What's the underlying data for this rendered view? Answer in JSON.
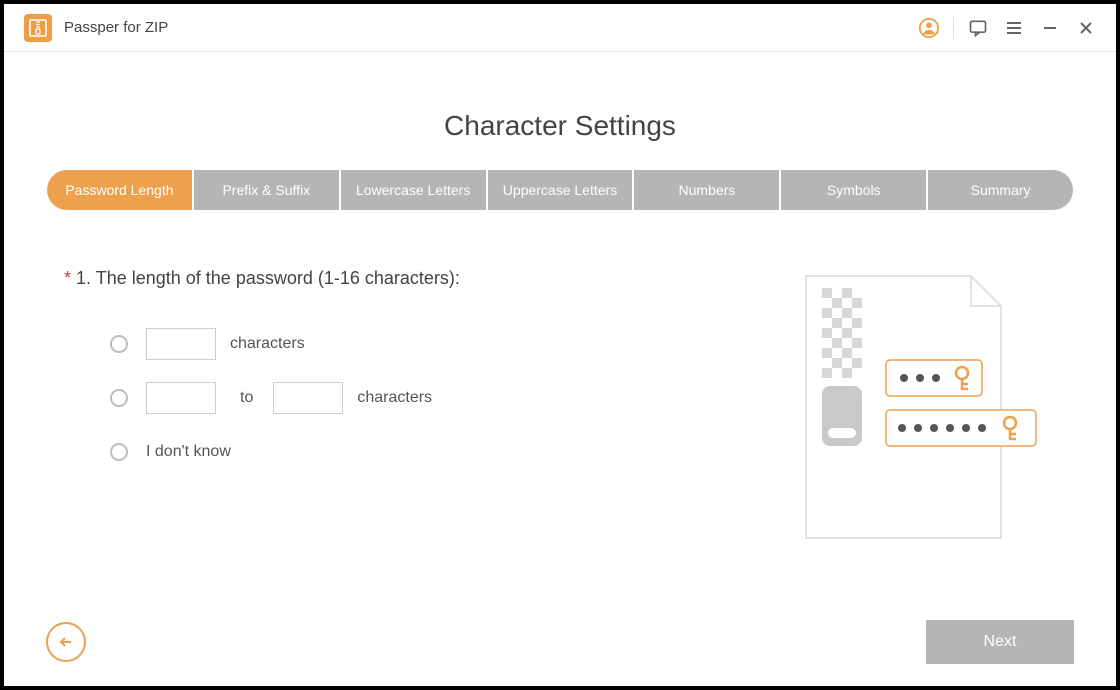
{
  "app": {
    "title": "Passper for ZIP"
  },
  "page": {
    "title": "Character Settings"
  },
  "tabs": [
    {
      "label": "Password Length",
      "active": true
    },
    {
      "label": "Prefix & Suffix"
    },
    {
      "label": "Lowercase Letters"
    },
    {
      "label": "Uppercase Letters"
    },
    {
      "label": "Numbers"
    },
    {
      "label": "Symbols"
    },
    {
      "label": "Summary"
    }
  ],
  "question": {
    "required_mark": "*",
    "text": "1. The length of the password (1-16 characters):"
  },
  "options": {
    "exact": {
      "chars_label": "characters",
      "value": ""
    },
    "range": {
      "to_label": "to",
      "chars_label": "characters",
      "from": "",
      "to": ""
    },
    "unknown": {
      "label": "I don't know"
    }
  },
  "footer": {
    "next_label": "Next"
  }
}
